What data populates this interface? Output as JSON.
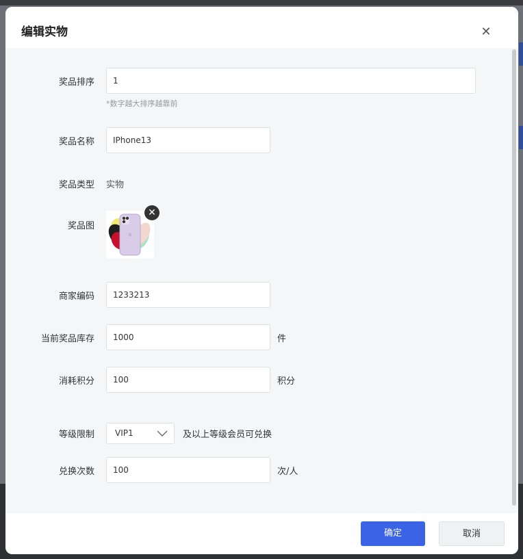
{
  "dialog": {
    "title": "编辑实物",
    "close_icon": "close-icon"
  },
  "form": {
    "sort": {
      "label": "奖品排序",
      "value": "1",
      "hint": "*数字越大排序越靠前"
    },
    "name": {
      "label": "奖品名称",
      "value": "IPhone13"
    },
    "type": {
      "label": "奖品类型",
      "value": "实物"
    },
    "image": {
      "label": "奖品图",
      "remove_icon": "remove-circle-icon"
    },
    "merchant_code": {
      "label": "商家编码",
      "value": "1233213"
    },
    "stock": {
      "label": "当前奖品库存",
      "value": "1000",
      "unit": "件"
    },
    "points": {
      "label": "消耗积分",
      "value": "100",
      "unit": "积分"
    },
    "level": {
      "label": "等级限制",
      "selected": "VIP1",
      "suffix": "及以上等级会员可兑换"
    },
    "exchange_count": {
      "label": "兑换次数",
      "value": "100",
      "unit": "次/人"
    }
  },
  "footer": {
    "confirm_label": "确定",
    "cancel_label": "取消"
  },
  "colors": {
    "primary": "#3a63e6",
    "form_bg": "#f5f6f8"
  }
}
